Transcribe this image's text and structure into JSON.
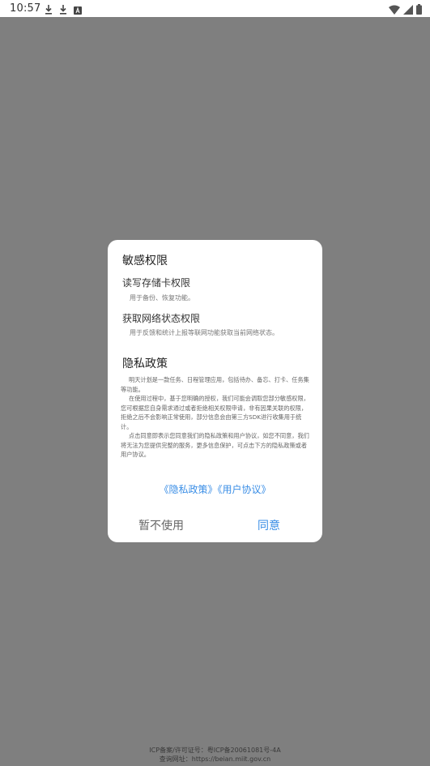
{
  "status_bar": {
    "time": "10:57",
    "icons_left": [
      "download-icon",
      "download-icon",
      "text-notification-icon"
    ],
    "icons_right": [
      "wifi-icon",
      "signal-icon",
      "battery-icon"
    ]
  },
  "dialog": {
    "permissions_title": "敏感权限",
    "permissions": [
      {
        "name": "读写存储卡权限",
        "desc": "用于备份、恢复功能。"
      },
      {
        "name": "获取网络状态权限",
        "desc": "用于反馈和统计上报等联网功能获取当前网络状态。"
      }
    ],
    "privacy_title": "隐私政策",
    "privacy_paragraphs": [
      "明天计划是一款任务、日程管理应用，包括待办、备忘、打卡、任务集等功能。",
      "在使用过程中，基于您明确的授权，我们可能会调取您部分敏感权限，您可根据您自身需求通过或者拒绝相关权限申请，非有因果关联的权限，拒绝之后不会影响正常使用，部分信息会由第三方SDK进行收集用于统计。",
      "点击同意即表示您同意我们的隐私政策和用户协议，如您不同意，我们将无法为您提供完整的服务，更多信息保护，可点击下方的隐私政策或者用户协议。"
    ],
    "privacy_link": "《隐私政策》",
    "terms_link": "《用户协议》",
    "cancel_label": "暂不使用",
    "agree_label": "同意"
  },
  "footer": {
    "icp": "ICP备案/许可证号：粤ICP备20061081号-4A",
    "query_url": "查询网址：https://beian.miit.gov.cn"
  },
  "colors": {
    "overlay": "#7f7f7f",
    "accent": "#3a8ee6"
  }
}
